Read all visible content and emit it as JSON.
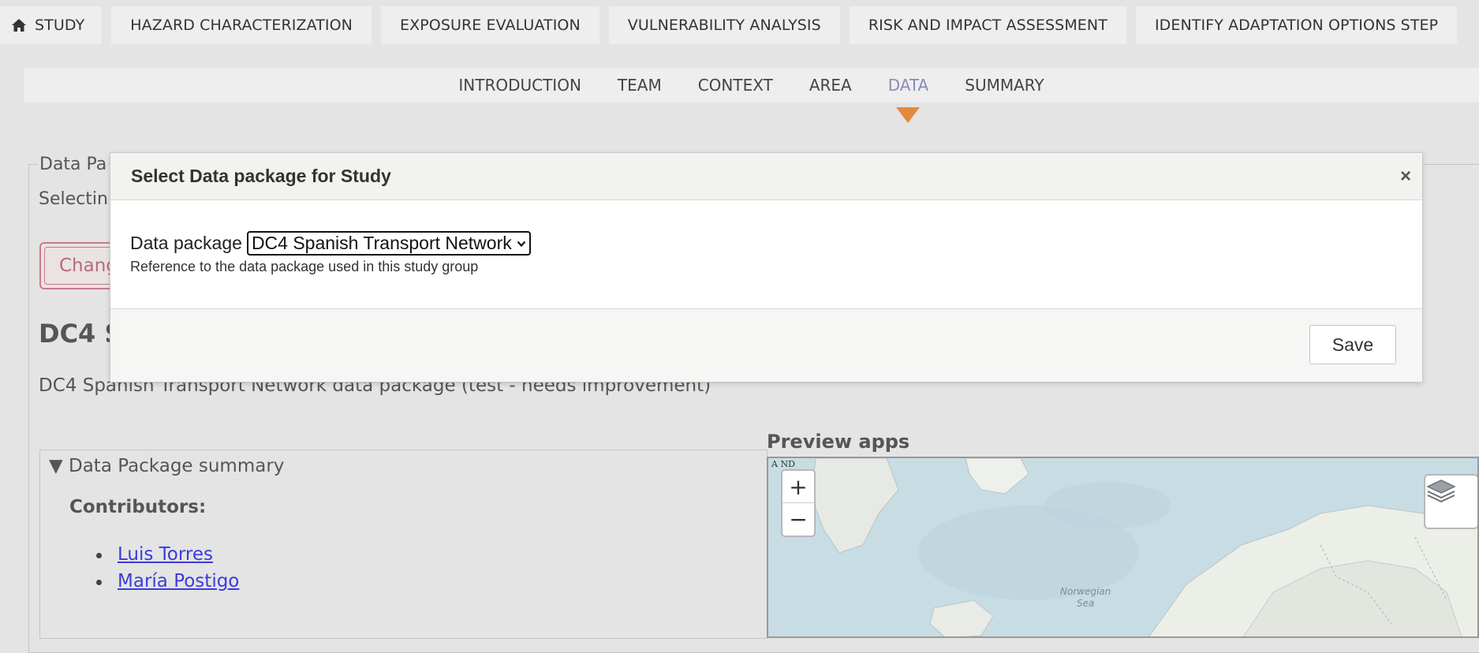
{
  "top_nav": {
    "items": [
      {
        "label": "STUDY",
        "icon": "home-icon"
      },
      {
        "label": "HAZARD CHARACTERIZATION"
      },
      {
        "label": "EXPOSURE EVALUATION"
      },
      {
        "label": "VULNERABILITY ANALYSIS"
      },
      {
        "label": "RISK AND IMPACT ASSESSMENT"
      },
      {
        "label": "IDENTIFY ADAPTATION OPTIONS STEP"
      }
    ]
  },
  "sub_nav": {
    "items": [
      "INTRODUCTION",
      "TEAM",
      "CONTEXT",
      "AREA",
      "DATA",
      "SUMMARY"
    ],
    "active": "DATA"
  },
  "page": {
    "legend": "Data Pa",
    "selecting_text": "Selectin",
    "change_button": "Chang",
    "package_title": "DC4 S",
    "package_description": "DC4 Spanish Transport Network data package (test - needs improvement)"
  },
  "summary": {
    "toggle": "▼ Data Package summary",
    "contributors_label": "Contributors:",
    "contributors": [
      "Luis Torres",
      "María Postigo"
    ]
  },
  "preview": {
    "label": "Preview apps",
    "attribution": "A ND",
    "zoom_in": "+",
    "zoom_out": "−",
    "sea_label_line1": "Norwegian",
    "sea_label_line2": "Sea"
  },
  "modal": {
    "title": "Select Data package for Study",
    "close": "×",
    "field_label": "Data package",
    "selected_value": "DC4 Spanish Transport Network",
    "help_text": "Reference to the data package used in this study group",
    "save_button": "Save"
  },
  "colors": {
    "active_tab": "#8a8ab8",
    "arrow": "#e08a3c",
    "link": "#3b3bdd",
    "danger_button": "#c67b8a"
  }
}
